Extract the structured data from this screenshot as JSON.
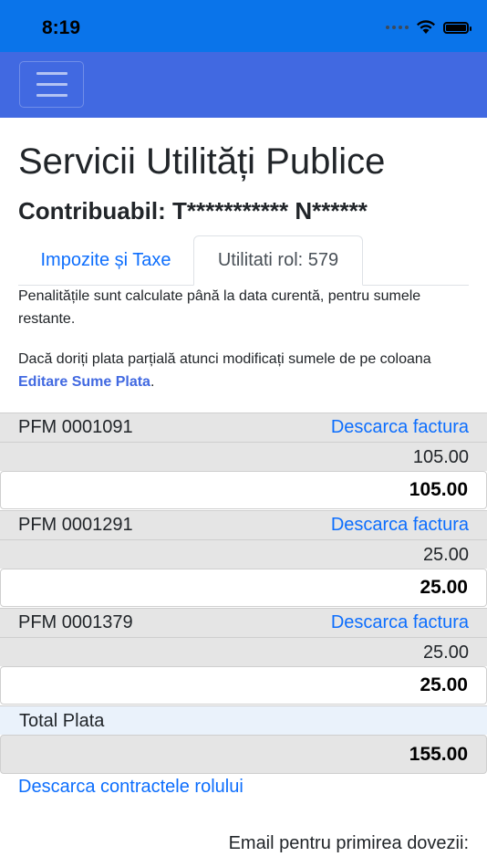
{
  "status_bar": {
    "time": "8:19"
  },
  "page": {
    "title": "Servicii Utilități Publice",
    "subtitle": "Contribuabil: T*********** N******"
  },
  "tabs": [
    {
      "label": "Impozite și Taxe",
      "active": false
    },
    {
      "label": "Utilitati rol: 579",
      "active": true
    }
  ],
  "notes": {
    "penalties": "Penalitățile sunt calculate până la data curentă, pentru sumele restante.",
    "partial_prefix": "Dacă doriți plata parțială atunci modificați sumele de pe coloana ",
    "partial_bold": "Editare Sume Plata",
    "partial_suffix": "."
  },
  "invoices": [
    {
      "code": "PFM 0001091",
      "link": "Descarca factura",
      "amount": "105.00",
      "total": "105.00"
    },
    {
      "code": "PFM 0001291",
      "link": "Descarca factura",
      "amount": "25.00",
      "total": "25.00"
    },
    {
      "code": "PFM 0001379",
      "link": "Descarca factura",
      "amount": "25.00",
      "total": "25.00"
    }
  ],
  "summary": {
    "label": "Total Plata",
    "value": "155.00"
  },
  "links": {
    "contracts": "Descarca contractele rolului"
  },
  "email_label": "Email pentru primirea dovezii:",
  "colors": {
    "status_bar": "#0a74ea",
    "navbar": "#4169e1",
    "link": "#0d6efd",
    "total_row": "#eaf2fb"
  }
}
